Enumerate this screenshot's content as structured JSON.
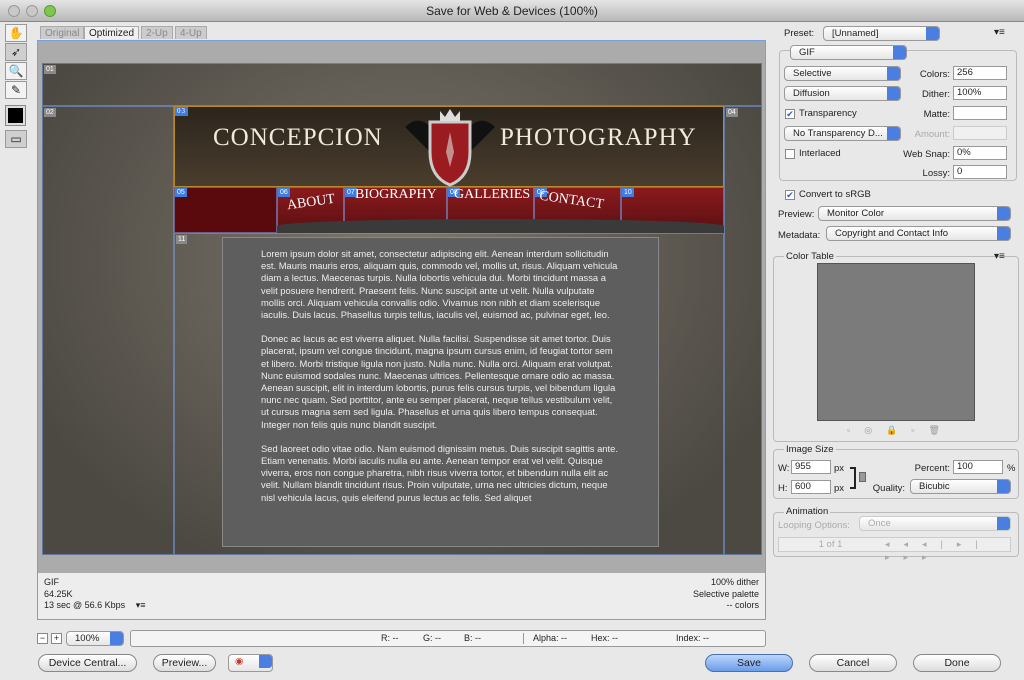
{
  "window": {
    "title": "Save for Web & Devices (100%)"
  },
  "tabs": [
    "Original",
    "Optimized",
    "2-Up",
    "4-Up"
  ],
  "active_tab": "Optimized",
  "slices": {
    "s01": "01",
    "s02": "02",
    "s03": "03",
    "s04": "04",
    "s05": "05",
    "s06": "06",
    "s07": "07",
    "s08": "08",
    "s09": "09",
    "s10": "10",
    "s11": "11"
  },
  "site": {
    "title_left": "CONCEPCION",
    "title_right": "PHOTOGRAPHY",
    "nav": [
      "ABOUT",
      "BIOGRAPHY",
      "GALLERIES",
      "CONTACT"
    ],
    "paragraphs": [
      "Lorem ipsum dolor sit amet, consectetur adipiscing elit. Aenean interdum sollicitudin est. Mauris mauris eros, aliquam quis, commodo vel, mollis ut, risus. Aliquam vehicula diam a lectus. Maecenas turpis. Nulla lobortis vehicula dui. Morbi tincidunt massa a velit posuere hendrerit. Praesent felis. Nunc suscipit ante ut velit. Nulla vulputate mollis orci. Aliquam vehicula convallis odio. Vivamus non nibh et diam scelerisque iaculis. Duis lacus. Phasellus turpis tellus, iaculis vel, euismod ac, pulvinar eget, leo.",
      "Donec ac lacus ac est viverra aliquet. Nulla facilisi. Suspendisse sit amet tortor. Duis placerat, ipsum vel congue tincidunt, magna ipsum cursus enim, id feugiat tortor sem et libero. Morbi tristique ligula non justo. Nulla nunc. Nulla orci. Aliquam erat volutpat. Nunc euismod sodales nunc. Maecenas ultrices. Pellentesque ornare odio ac massa. Aenean suscipit, elit in interdum lobortis, purus felis cursus turpis, vel bibendum ligula nunc nec quam. Sed porttitor, ante eu semper placerat, neque tellus vestibulum velit, ut cursus magna sem sed ligula. Phasellus et urna quis libero tempus consequat. Integer non felis quis nunc blandit suscipit.",
      "Sed laoreet odio vitae odio. Nam euismod dignissim metus. Duis suscipit sagittis ante. Etiam venenatis. Morbi iaculis nulla eu ante. Aenean tempor erat vel velit. Quisque viverra, eros non congue pharetra, nibh risus viverra tortor, et bibendum nulla elit ac velit. Nullam blandit tincidunt risus. Proin vulputate, urna nec ultricies dictum, neque nisl vehicula lacus, quis eleifend purus lectus ac felis. Sed aliquet"
    ]
  },
  "info": {
    "format": "GIF",
    "size": "64.25K",
    "time": "13 sec @ 56.6 Kbps",
    "dither": "100% dither",
    "palette": "Selective palette",
    "colors": "-- colors"
  },
  "status": {
    "zoom": "100%",
    "r": "R: --",
    "g": "G: --",
    "b": "B: --",
    "alpha": "Alpha: --",
    "hex": "Hex: --",
    "index": "Index: --"
  },
  "buttons": {
    "device_central": "Device Central...",
    "preview": "Preview...",
    "save": "Save",
    "cancel": "Cancel",
    "done": "Done"
  },
  "settings": {
    "preset_label": "Preset:",
    "preset": "[Unnamed]",
    "format": "GIF",
    "reduction": "Selective",
    "dither_algo": "Diffusion",
    "colors_label": "Colors:",
    "colors": "256",
    "dither_label": "Dither:",
    "dither": "100%",
    "transparency": "Transparency",
    "transparency_checked": true,
    "matte_label": "Matte:",
    "matte": "",
    "trans_dither": "No Transparency D...",
    "amount_label": "Amount:",
    "amount": "",
    "interlaced": "Interlaced",
    "interlaced_checked": false,
    "websnap_label": "Web Snap:",
    "websnap": "0%",
    "lossy_label": "Lossy:",
    "lossy": "0",
    "srgb": "Convert to sRGB",
    "srgb_checked": true,
    "preview_label": "Preview:",
    "preview": "Monitor Color",
    "metadata_label": "Metadata:",
    "metadata": "Copyright and Contact Info"
  },
  "color_table": {
    "title": "Color Table"
  },
  "image_size": {
    "title": "Image Size",
    "w_label": "W:",
    "w": "955",
    "h_label": "H:",
    "h": "600",
    "unit": "px",
    "percent_label": "Percent:",
    "percent": "100",
    "percent_unit": "%",
    "quality_label": "Quality:",
    "quality": "Bicubic"
  },
  "animation": {
    "title": "Animation",
    "looping_label": "Looping Options:",
    "looping": "Once",
    "frame": "1 of 1"
  },
  "colors": {
    "accent": "#3f7de0",
    "ribbon": "#8b1a1d"
  }
}
